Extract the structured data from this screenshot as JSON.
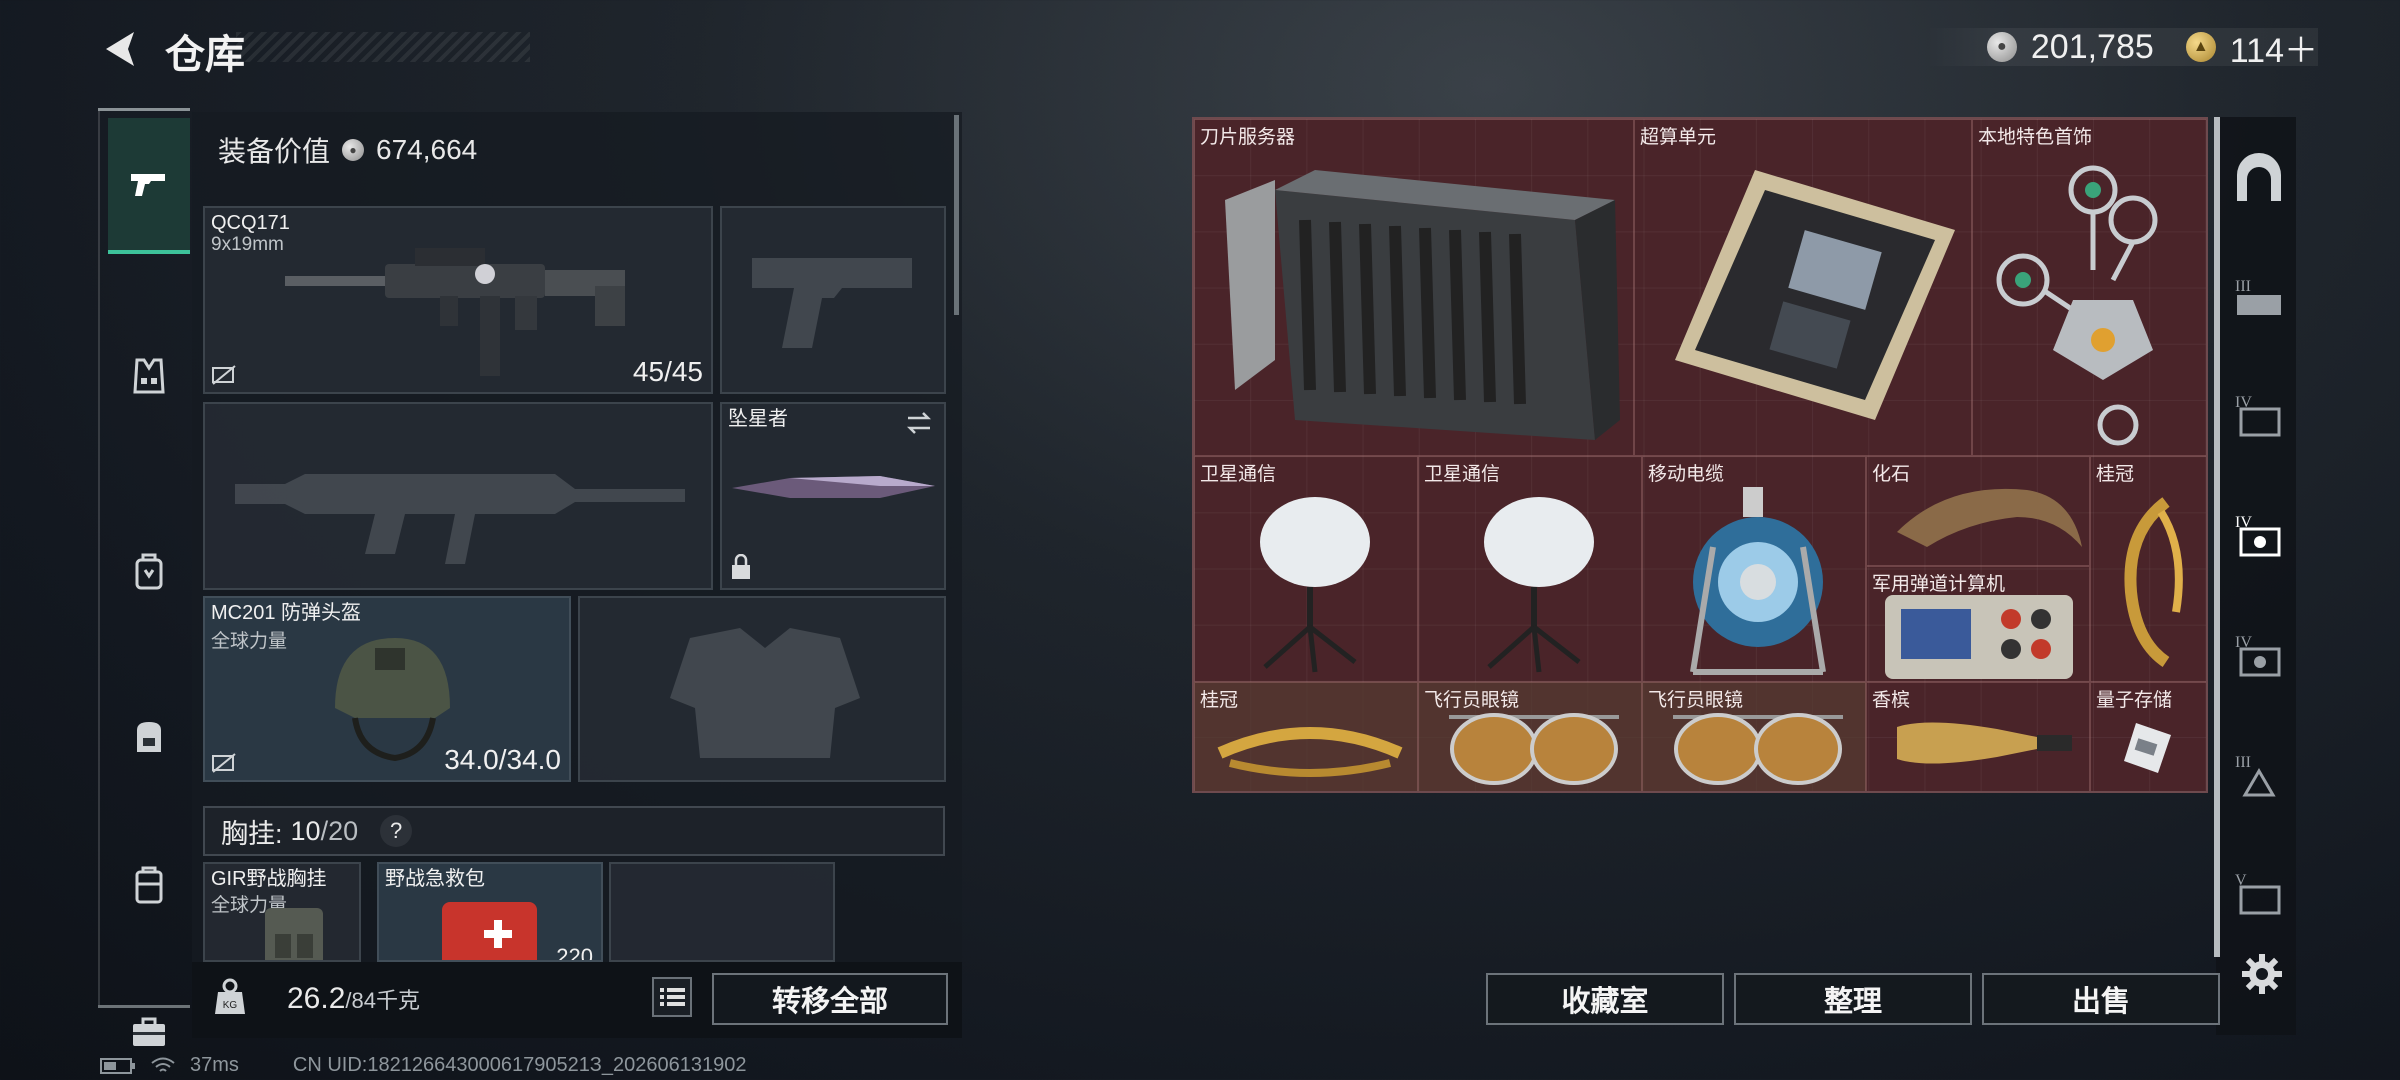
{
  "header": {
    "title": "仓库",
    "currency_silver": "201,785",
    "currency_gold": "114＋"
  },
  "left_tabs": [
    {
      "icon": "pistol-icon",
      "active": true
    },
    {
      "icon": "armor-vest-icon"
    },
    {
      "icon": "backpack-rig-icon"
    },
    {
      "icon": "backpack-icon"
    },
    {
      "icon": "case-icon"
    },
    {
      "icon": "toolbox-icon"
    }
  ],
  "equipment": {
    "value_label": "装备价值",
    "value": "674,664",
    "primary": {
      "name": "QCQ171",
      "ammo": "9x19mm",
      "count": "45/45"
    },
    "melee": {
      "name": "坠星者"
    },
    "helmet": {
      "name": "MC201 防弹头盔",
      "sub": "全球力量",
      "durability": "34.0/34.0"
    },
    "vest": {
      "label": "胸挂:",
      "capacity": "10",
      "capacity_max": "/20",
      "help": "?"
    },
    "vest_items": [
      {
        "name": "GIR野战胸挂",
        "sub": "全球力量"
      },
      {
        "name": "野战急救包",
        "count": "220"
      }
    ]
  },
  "weight": {
    "value": "26.2",
    "max": "/84千克"
  },
  "buttons": {
    "transfer_all": "转移全部",
    "collection": "收藏室",
    "organize": "整理",
    "sell": "出售"
  },
  "grid_items": [
    {
      "label": "刀片服务器",
      "icon": "blade-server-icon"
    },
    {
      "label": "超算单元",
      "icon": "supercomputer-board-icon"
    },
    {
      "label": "本地特色首饰",
      "icon": "jewelry-icon"
    },
    {
      "label": "卫星通信",
      "icon": "satellite-dish-icon"
    },
    {
      "label": "卫星通信",
      "icon": "satellite-dish-icon"
    },
    {
      "label": "移动电缆",
      "icon": "cable-reel-icon"
    },
    {
      "label": "化石",
      "icon": "fossil-claw-icon"
    },
    {
      "label": "桂冠",
      "icon": "laurel-icon"
    },
    {
      "label": "军用弹道计算机",
      "icon": "ballistic-computer-icon"
    },
    {
      "label": "桂冠",
      "icon": "laurel-icon"
    },
    {
      "label": "飞行员眼镜",
      "icon": "aviator-glasses-icon"
    },
    {
      "label": "飞行员眼镜",
      "icon": "aviator-glasses-icon"
    },
    {
      "label": "香槟",
      "icon": "champagne-icon"
    },
    {
      "label": "量子存储",
      "icon": "quantum-storage-icon"
    }
  ],
  "status": {
    "ping": "37ms",
    "uid": "CN UID:18212664300061790521З_202606131902"
  },
  "colors": {
    "grid_bg": "#4a2429",
    "accent_green": "#3dc29a"
  }
}
